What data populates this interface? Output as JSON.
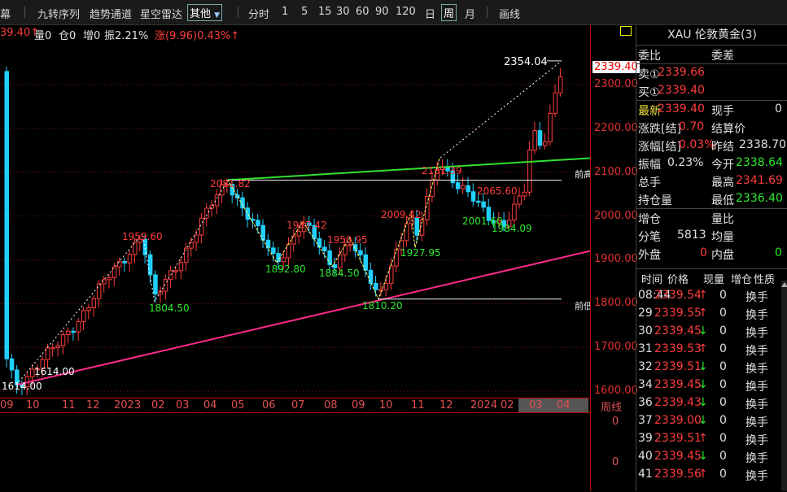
{
  "toolbar": {
    "items": [
      "幕",
      "九转序列",
      "趋势通道",
      "星空雷达",
      "其他",
      "分时",
      "1",
      "5",
      "15",
      "30",
      "60",
      "90",
      "120",
      "日",
      "周",
      "月",
      "画线"
    ],
    "other_dropdown": "其他",
    "selected_period": "周"
  },
  "info": {
    "price": "39.40↑",
    "vol": "量0",
    "oi": "仓0",
    "incr": "增0",
    "amp": "振2.21%",
    "chg": "涨(9.96)0.43%↑"
  },
  "yaxis": {
    "labels": [
      "2300.00",
      "2200.00",
      "2100.00",
      "2000.00",
      "1900.00",
      "1800.00",
      "1700.00",
      "1600.00"
    ],
    "current": "2339.40"
  },
  "annotations": {
    "high": "2354.04",
    "prev_high": "前高",
    "prev_low": "前低",
    "points": [
      "1614.00",
      "1614.00",
      "1959.60",
      "1804.50",
      "2081.82",
      "1892.80",
      "1987.42",
      "1950.95",
      "1884.50",
      "1810.20",
      "2009.42",
      "1927.95",
      "2131.39",
      "2065.60",
      "2001.60",
      "1984.09"
    ]
  },
  "xaxis": {
    "labels": [
      "09",
      "10",
      "11",
      "12",
      "2023",
      "02",
      "03",
      "04",
      "05",
      "06",
      "07",
      "08",
      "09",
      "10",
      "11",
      "12",
      "2024",
      "02",
      "03",
      "04"
    ],
    "period_label": "周线"
  },
  "lower": {
    "values": [
      "0",
      "0"
    ]
  },
  "quote": {
    "title": "XAU 伦敦黄金(3)",
    "weibi_label": "委比",
    "weicha_label": "委差",
    "sell_label": "卖①",
    "sell": "2339.66",
    "buy_label": "买①",
    "buy": "2339.40",
    "last_label": "最新",
    "last": "2339.40",
    "xianshou_label": "现手",
    "xianshou": "0",
    "zhangdie_label": "涨跌[结]",
    "zhangdie": "0.70",
    "jiesuan_label": "结算价",
    "zhangfu_label": "涨幅[结]",
    "zhangfu": "0.03%",
    "zuojie_label": "昨结",
    "zuojie": "2338.70",
    "zhenfu_label": "振幅",
    "zhenfu": "0.23%",
    "jinkai_label": "今开",
    "jinkai": "2338.64",
    "zongshou_label": "总手",
    "zuigao_label": "最高",
    "zuigao": "2341.69",
    "chicang_label": "持仓量",
    "zuidi_label": "最低",
    "zuidi": "2336.40",
    "zengcang_label": "增仓",
    "liangbi_label": "量比",
    "fenbi_label": "分笔",
    "fenbi": "5813",
    "junliang_label": "均量",
    "waipan_label": "外盘",
    "waipan": "0",
    "neipan_label": "内盘",
    "neipan": "0"
  },
  "ticks": {
    "headers": [
      "时间",
      "价格",
      "现量",
      "增仓",
      "性质"
    ],
    "rows": [
      {
        "time": "08:44",
        "price": "2339.54",
        "dir": "↑",
        "vol": "0",
        "nature": "换手"
      },
      {
        "time": "29",
        "price": "2339.55",
        "dir": "↑",
        "vol": "0",
        "nature": "换手"
      },
      {
        "time": "30",
        "price": "2339.45",
        "dir": "↓",
        "vol": "0",
        "nature": "换手"
      },
      {
        "time": "31",
        "price": "2339.53",
        "dir": "↑",
        "vol": "0",
        "nature": "换手"
      },
      {
        "time": "32",
        "price": "2339.51",
        "dir": "↓",
        "vol": "0",
        "nature": "换手"
      },
      {
        "time": "34",
        "price": "2339.45",
        "dir": "↓",
        "vol": "0",
        "nature": "换手"
      },
      {
        "time": "36",
        "price": "2339.43",
        "dir": "↓",
        "vol": "0",
        "nature": "换手"
      },
      {
        "time": "37",
        "price": "2339.00",
        "dir": "↓",
        "vol": "0",
        "nature": "换手"
      },
      {
        "time": "39",
        "price": "2339.51",
        "dir": "↑",
        "vol": "0",
        "nature": "换手"
      },
      {
        "time": "40",
        "price": "2339.45",
        "dir": "↓",
        "vol": "0",
        "nature": "换手"
      },
      {
        "time": "41",
        "price": "2339.56",
        "dir": "↑",
        "vol": "0",
        "nature": "换手"
      }
    ]
  },
  "colors": {
    "up": "#ff3c3c",
    "down": "#20d0ff",
    "trend_green": "#30e030",
    "trend_pink": "#ff2a8a"
  }
}
